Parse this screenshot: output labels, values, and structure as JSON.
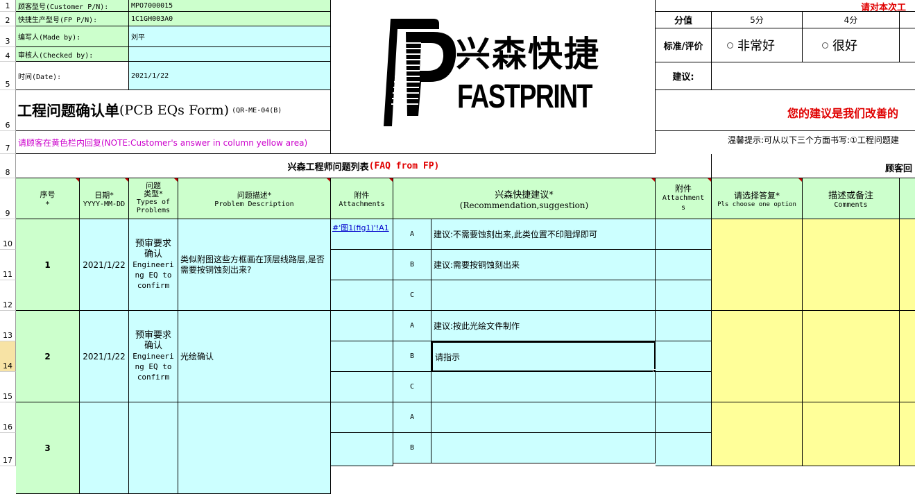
{
  "row_numbers": [
    "1",
    "2",
    "3",
    "4",
    "5",
    "6",
    "7",
    "8",
    "9",
    "10",
    "11",
    "12",
    "13",
    "14",
    "15",
    "16",
    "17"
  ],
  "info": {
    "customer_pn_label": "顾客型号(Customer P/N):",
    "customer_pn_value": "MPO7000015",
    "fp_pn_label": "快捷生产型号(FP P/N):",
    "fp_pn_value": "1C1GH003A0",
    "made_by_label": "编写人(Made by):",
    "made_by_value": "刘平",
    "checked_by_label": "审核人(Checked by):",
    "checked_by_value": "",
    "date_label": "时间(Date):",
    "date_value": "2021/1/22"
  },
  "logo": {
    "cn": "兴森快捷",
    "en": "FASTPRINT"
  },
  "form": {
    "title_cn": "工程问题确认单",
    "title_en": "(PCB EQs Form)",
    "code": "(QR-ME-04(B)",
    "note": "请顾客在黄色栏内回复(NOTE:Customer's answer in column yellow area)"
  },
  "rating": {
    "header": "请对本次工",
    "score_label": "分值",
    "score_5": "5分",
    "score_4": "4分",
    "criteria_label": "标准/评价",
    "opt_very_good": "非常好",
    "opt_good": "很好",
    "suggest_label": "建议:",
    "slogan": "您的建议是我们改善的",
    "hint": "温馨提示:可从以下三个方面书写:①工程问题建"
  },
  "table": {
    "fp_section": "兴森工程师问题列表",
    "fp_section_tag": "(FAQ from FP)",
    "cust_section": "顾客回",
    "h_seq": "序号",
    "h_seq_star": "*",
    "h_date": "日期*",
    "h_date_fmt": "YYYY-MM-DD",
    "h_type_1": "问题",
    "h_type_2": "类型*",
    "h_type_3": "Types of",
    "h_type_4": "Problems",
    "h_desc": "问题描述*",
    "h_desc_en": "Problem Description",
    "h_att": "附件",
    "h_att_en": "Attachments",
    "h_rec": "兴森快捷建议*",
    "h_rec_en": "(Recommendation,suggestion)",
    "h_att2_1": "附件",
    "h_att2_2": "Attachment",
    "h_att2_3": "s",
    "h_choose": "请选择答复*",
    "h_choose_en": "Pls choose one option",
    "h_comment": "描述或备注",
    "h_comment_en": "Comments"
  },
  "problems": [
    {
      "seq": "1",
      "date": "2021/1/22",
      "type_cn_1": "预审要求",
      "type_cn_2": "确认",
      "type_en": "Engineering EQ to confirm",
      "desc": "类似附图这些方框画在顶层线路层,是否需要按铜蚀刻出来?",
      "attachment": "#'图1(fig1)'!A1",
      "options": [
        {
          "letter": "A",
          "text": "建议:不需要蚀刻出来,此类位置不印阻焊即可"
        },
        {
          "letter": "B",
          "text": "建议:需要按铜蚀刻出来"
        },
        {
          "letter": "C",
          "text": ""
        }
      ]
    },
    {
      "seq": "2",
      "date": "2021/1/22",
      "type_cn_1": "预审要求",
      "type_cn_2": "确认",
      "type_en": "Engineering EQ to confirm",
      "desc": "光绘确认",
      "attachment": "",
      "options": [
        {
          "letter": "A",
          "text": "建议:按此光绘文件制作"
        },
        {
          "letter": "B",
          "text": "请指示"
        },
        {
          "letter": "C",
          "text": ""
        }
      ]
    },
    {
      "seq": "3",
      "date": "",
      "type_cn_1": "",
      "type_cn_2": "",
      "type_en": "",
      "desc": "",
      "attachment": "",
      "options": [
        {
          "letter": "A",
          "text": ""
        },
        {
          "letter": "B",
          "text": ""
        }
      ]
    }
  ]
}
